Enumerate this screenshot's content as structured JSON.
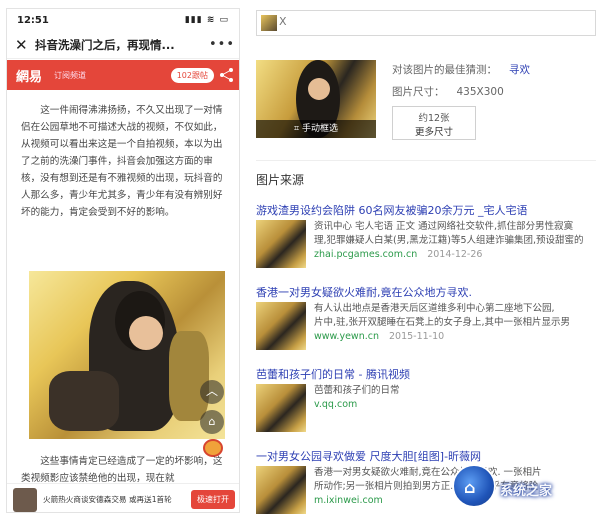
{
  "phone": {
    "status_time": "12:51",
    "status_icons": "▮▮▮ ≋ ▭",
    "article_title": "抖音洗澡门之后，再现情...",
    "more_label": "•••",
    "source_logo": "網易",
    "channel": "订阅频道",
    "comments": "102跟帖",
    "paragraph_1": "这一件闹得沸沸扬扬，不久又出现了一对情侣在公园草地不可描述大战的视频，不仅如此，从视频可以看出来这是一个自拍视频，本以为出了之前的洗澡门事件，抖音会加强这方面的审核，没有想到还是有不雅视频的出现，玩抖音的人那么多，青少年尤其多，青少年有没有辨别好坏的能力，肯定会受到不好的影响。",
    "paragraph_2": "这些事情肯定已经造成了一定的坏影响，这类视频影应该禁绝他的出现，现在就",
    "promo_text": "火箭热火商谈安德森交易 或再送1首轮",
    "promo_button": "极速打开"
  },
  "results": {
    "query_close": "X",
    "best_guess_label": "对该图片的最佳猜测：",
    "best_guess_value": "寻欢",
    "size_label": "图片尺寸：",
    "size_value": "435X300",
    "count_label": "约12张",
    "more_sizes": "更多尺寸",
    "crop_label": "手动框选",
    "section_title": "图片来源",
    "items": [
      {
        "title": "游戏渣男设约会陷阱 60名网友被骗20余万元 _宅人宅语",
        "desc": "资讯中心 宅人宅语 正文 通过网络社交软件,抓住部分男性寂寞",
        "desc2": "理,犯罪嫌疑人白某(男,黑龙江籍)等5人组建诈骗集团,预设甜蜜的",
        "url": "zhai.pcgames.com.cn",
        "date": "2014-12-26"
      },
      {
        "title": "香港一对男女疑欲火难耐,竟在公众地方寻欢.",
        "desc": "有人认出地点是香港天后区道维多利中心第二座地下公园,",
        "desc2": "片中,驻,张开双腿睡在石凳上的女子身上,其中一张相片显示男",
        "url": "www.yewn.cn",
        "date": "2015-11-10"
      },
      {
        "title": "芭蕾和孩子们的日常 - 腾讯视频",
        "desc": "芭蕾和孩子们的日常",
        "desc2": "",
        "url": "v.qq.com",
        "date": ""
      },
      {
        "title": "一对男女公园寻欢做爱 尺度大胆[组图]-昕薇网",
        "desc": "香港一对男女疑欲火难耐,竟在公众地方寻欢. 一张相片",
        "desc2": "所动作;另一张相片则拍到男方正... 女子似乎有意将脸",
        "url": "m.ixinwei.com",
        "date": ""
      }
    ],
    "watermark": "系统之家"
  }
}
